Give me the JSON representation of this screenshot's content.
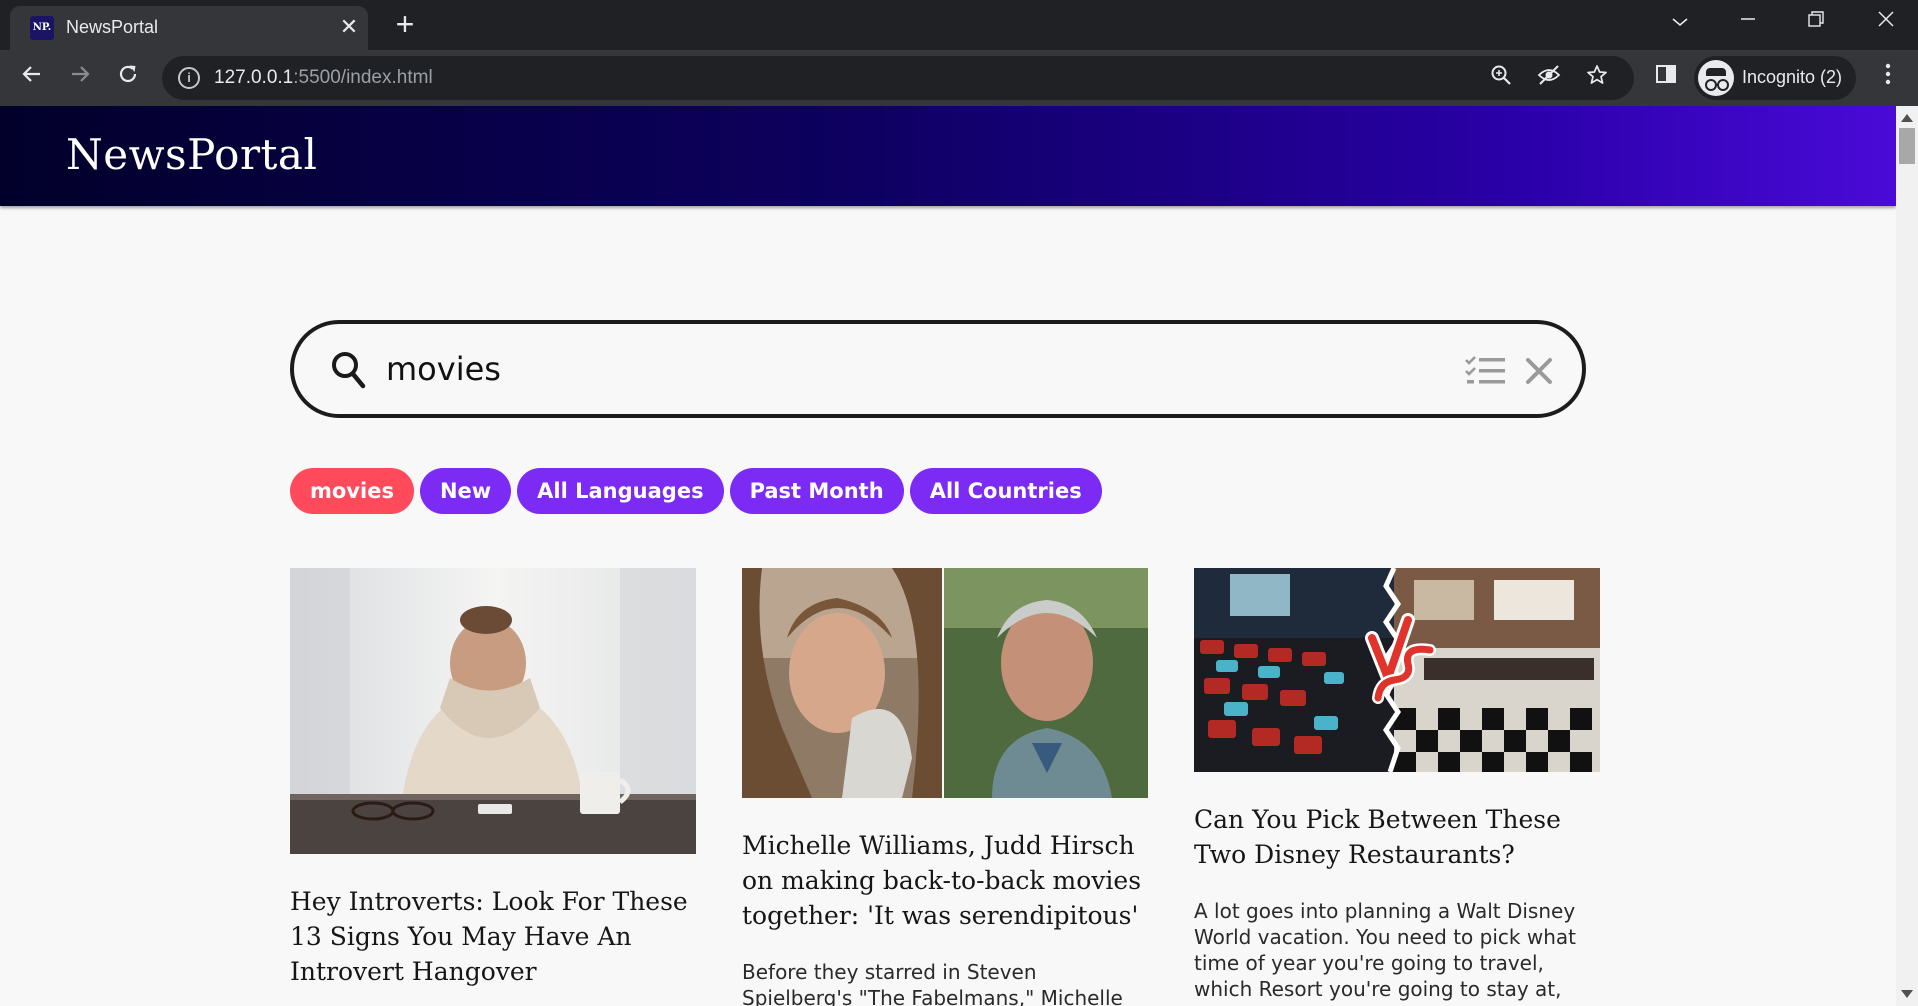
{
  "browser": {
    "tab_title": "NewsPortal",
    "favicon_text": "NP.",
    "url_host": "127.0.0.1",
    "url_rest": ":5500/index.html",
    "incognito_label": "Incognito (2)"
  },
  "site": {
    "brand": "NewsPortal"
  },
  "search": {
    "value": "movies",
    "placeholder": ""
  },
  "filters": [
    {
      "label": "movies",
      "active": true
    },
    {
      "label": "New",
      "active": false
    },
    {
      "label": "All Languages",
      "active": false
    },
    {
      "label": "Past Month",
      "active": false
    },
    {
      "label": "All Countries",
      "active": false
    }
  ],
  "articles": [
    {
      "title": "Hey Introverts: Look For These 13 Signs You May Have An Introvert Hangover",
      "description": ""
    },
    {
      "title": "Michelle Williams, Judd Hirsch on making back-to-back movies together: 'It was serendipitous'",
      "description": "Before they starred in Steven Spielberg's \"The Fabelmans,\" Michelle Williams and"
    },
    {
      "title": "Can You Pick Between These Two Disney Restaurants?",
      "description": "A lot goes into planning a Walt Disney World vacation. You need to pick what time of year you're going to travel, which Resort you're going to stay at, which"
    }
  ],
  "colors": {
    "chip": "#7c2bf5",
    "chip_active": "#ff4a5c",
    "header_start": "#02002a",
    "header_end": "#4a0ad8"
  }
}
